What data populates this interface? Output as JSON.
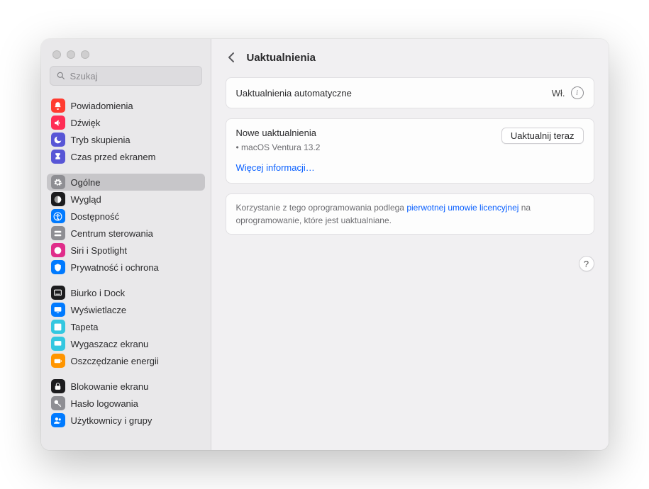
{
  "search": {
    "placeholder": "Szukaj"
  },
  "sidebar": {
    "groups": [
      [
        {
          "label": "Powiadomienia",
          "color": "#ff3b30",
          "icon": "bell"
        },
        {
          "label": "Dźwięk",
          "color": "#ff2d55",
          "icon": "speaker"
        },
        {
          "label": "Tryb skupienia",
          "color": "#5856d6",
          "icon": "moon"
        },
        {
          "label": "Czas przed ekranem",
          "color": "#5856d6",
          "icon": "hourglass"
        }
      ],
      [
        {
          "label": "Ogólne",
          "color": "#8e8e93",
          "icon": "gear",
          "selected": true
        },
        {
          "label": "Wygląd",
          "color": "#1c1c1e",
          "icon": "appearance"
        },
        {
          "label": "Dostępność",
          "color": "#007aff",
          "icon": "accessibility"
        },
        {
          "label": "Centrum sterowania",
          "color": "#8e8e93",
          "icon": "switches"
        },
        {
          "label": "Siri i Spotlight",
          "color": "#e02d8a",
          "icon": "siri"
        },
        {
          "label": "Prywatność i ochrona",
          "color": "#007aff",
          "icon": "hand"
        }
      ],
      [
        {
          "label": "Biurko i Dock",
          "color": "#1c1c1e",
          "icon": "dock"
        },
        {
          "label": "Wyświetlacze",
          "color": "#007aff",
          "icon": "display"
        },
        {
          "label": "Tapeta",
          "color": "#34c7e0",
          "icon": "wallpaper"
        },
        {
          "label": "Wygaszacz ekranu",
          "color": "#34c7e0",
          "icon": "screensaver"
        },
        {
          "label": "Oszczędzanie energii",
          "color": "#ff9500",
          "icon": "battery"
        }
      ],
      [
        {
          "label": "Blokowanie ekranu",
          "color": "#1c1c1e",
          "icon": "lock"
        },
        {
          "label": "Hasło logowania",
          "color": "#8e8e93",
          "icon": "key"
        },
        {
          "label": "Użytkownicy i grupy",
          "color": "#007aff",
          "icon": "users"
        }
      ]
    ]
  },
  "header": {
    "title": "Uaktualnienia"
  },
  "auto": {
    "label": "Uaktualnienia automatyczne",
    "status": "Wł."
  },
  "updates": {
    "heading": "Nowe uaktualnienia",
    "item": "macOS Ventura 13.2",
    "button": "Uaktualnij teraz",
    "more": "Więcej informacji…"
  },
  "legal": {
    "pre": "Korzystanie z tego oprogramowania podlega ",
    "link": "pierwotnej umowie licencyjnej",
    "post": " na oprogramowanie, które jest uaktualniane."
  },
  "help": "?"
}
